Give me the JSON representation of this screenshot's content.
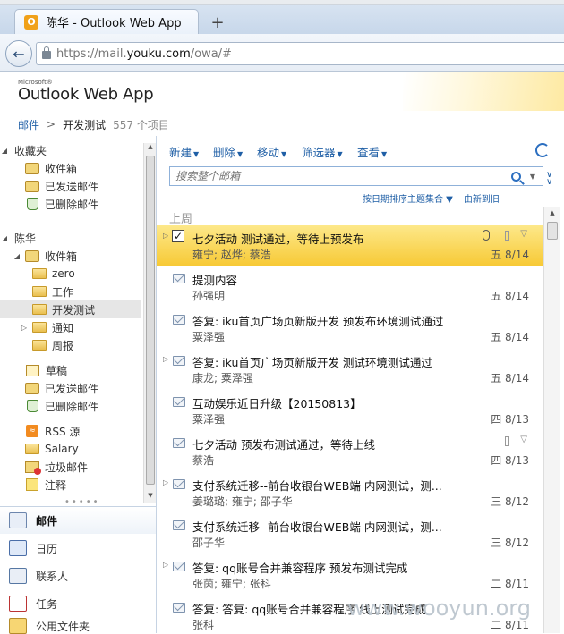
{
  "browser": {
    "tab_title": "陈华 - Outlook Web App",
    "new_tab": "+",
    "url_prefix": "https://mail.",
    "url_domain": "youku.com",
    "url_suffix": "/owa/#"
  },
  "app": {
    "ms_label": "Microsoft®",
    "name": "Outlook Web App"
  },
  "breadcrumb": {
    "root": "邮件",
    "sep": ">",
    "folder": "开发测试",
    "count": "557 个项目"
  },
  "nav": {
    "favorites_header": "收藏夹",
    "favorites": [
      "收件箱",
      "已发送邮件",
      "已删除邮件"
    ],
    "account_header": "陈华",
    "inbox": "收件箱",
    "inbox_subfolders": [
      "zero",
      "工作",
      "开发测试",
      "通知",
      "周报"
    ],
    "others": [
      "草稿",
      "已发送邮件",
      "已删除邮件",
      "RSS 源",
      "Salary",
      "垃圾邮件",
      "注释"
    ],
    "modules": [
      "邮件",
      "日历",
      "联系人",
      "任务",
      "公用文件夹"
    ]
  },
  "toolbar": {
    "new": "新建",
    "delete": "删除",
    "move": "移动",
    "filter": "筛选器",
    "view": "查看"
  },
  "search": {
    "placeholder": "搜索整个邮箱"
  },
  "arrange": {
    "sort": "按日期排序主题集合",
    "order": "由新到旧"
  },
  "list": {
    "group": "上周",
    "messages": [
      {
        "subject": "七夕活动 测试通过，等待上预发布",
        "from": "雍宁; 赵烨; 蔡浩",
        "date": "五 8/14"
      },
      {
        "subject": "提测内容",
        "from": "孙强明",
        "date": "五 8/14"
      },
      {
        "subject": "答复: iku首页广场页新版开发 预发布环境测试通过",
        "from": "粟泽强",
        "date": "五 8/14"
      },
      {
        "subject": "答复: iku首页广场页新版开发 测试环境测试通过",
        "from": "康龙; 粟泽强",
        "date": "五 8/14"
      },
      {
        "subject": "互动娱乐近日升级【20150813】",
        "from": "粟泽强",
        "date": "四 8/13"
      },
      {
        "subject": "七夕活动 预发布测试通过，等待上线",
        "from": "蔡浩",
        "date": "四 8/13"
      },
      {
        "subject": "支付系统迁移--前台收银台WEB端 内网测试，测...",
        "from": "姜璐璐; 雍宁; 邵子华",
        "date": "三 8/12"
      },
      {
        "subject": "支付系统迁移--前台收银台WEB端 内网测试，测...",
        "from": "邵子华",
        "date": "三 8/12"
      },
      {
        "subject": "答复: qq账号合并兼容程序 预发布测试完成",
        "from": "张茵; 雍宁; 张科",
        "date": "二 8/11"
      },
      {
        "subject": "答复: 答复: qq账号合并兼容程序 线上测试完成",
        "from": "张科",
        "date": "二 8/11"
      }
    ]
  },
  "watermark": "www.wooyun.org"
}
